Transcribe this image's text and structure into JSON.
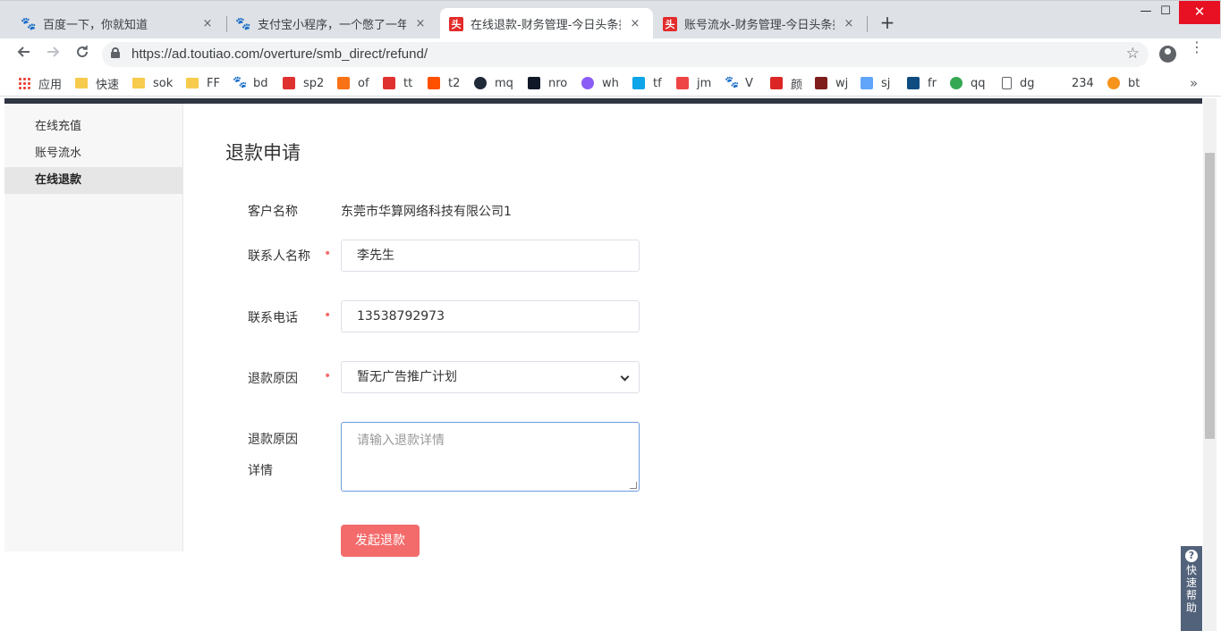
{
  "browser": {
    "tabs": [
      {
        "title": "百度一下，你就知道",
        "icon": "baidu-paw-icon"
      },
      {
        "title": "支付宝小程序，一个憋了一年的大",
        "icon": "baidu-paw-icon"
      },
      {
        "title": "在线退款-财务管理-今日头条投放",
        "icon": "toutiao-icon",
        "active": true
      },
      {
        "title": "账号流水-财务管理-今日头条投放",
        "icon": "toutiao-icon"
      }
    ],
    "favicon_text": "头",
    "close_glyph": "×",
    "new_tab_glyph": "+",
    "window_controls": {
      "minimize": "—",
      "maximize": "☐",
      "close": "✕"
    },
    "url": "https://ad.toutiao.com/overture/smb_direct/refund/",
    "bookmarks": [
      {
        "label": "应用",
        "icon": "apps-grid-icon"
      },
      {
        "label": "快速",
        "icon": "folder-icon"
      },
      {
        "label": "sok",
        "icon": "folder-icon"
      },
      {
        "label": "FF",
        "icon": "folder-icon"
      },
      {
        "label": "bd",
        "icon": "baidu-paw-icon"
      },
      {
        "label": "sp2",
        "icon": "wifi-icon"
      },
      {
        "label": "of",
        "icon": "flame-icon"
      },
      {
        "label": "tt",
        "icon": "red-badge-icon"
      },
      {
        "label": "t2",
        "icon": "taobao-icon"
      },
      {
        "label": "mq",
        "icon": "wave-icon"
      },
      {
        "label": "nro",
        "icon": "bag-icon"
      },
      {
        "label": "wh",
        "icon": "ring-icon"
      },
      {
        "label": "tf",
        "icon": "tf-icon"
      },
      {
        "label": "jm",
        "icon": "jm-icon"
      },
      {
        "label": "V",
        "icon": "baidu-paw-icon"
      },
      {
        "label": "颜",
        "icon": "fanyi-icon"
      },
      {
        "label": "wj",
        "icon": "w-logo-icon"
      },
      {
        "label": "sj",
        "icon": "sj-icon"
      },
      {
        "label": "fr",
        "icon": "fr-icon"
      },
      {
        "label": "qq",
        "icon": "google-icon"
      },
      {
        "label": "dg",
        "icon": "document-icon"
      },
      {
        "label": "234",
        "icon": ""
      },
      {
        "label": "bt",
        "icon": "bitcoin-icon"
      }
    ],
    "bookmarks_more": "»"
  },
  "sidebar": {
    "items": [
      {
        "label": "在线充值"
      },
      {
        "label": "账号流水"
      },
      {
        "label": "在线退款",
        "active": true
      }
    ]
  },
  "form": {
    "title": "退款申请",
    "customer_label": "客户名称",
    "customer_value": "东莞市华算网络科技有限公司1",
    "contact_label": "联系人名称",
    "contact_value": "李先生",
    "phone_label": "联系电话",
    "phone_value": "13538792973",
    "reason_label": "退款原因",
    "reason_value": "暂无广告推广计划",
    "detail_label_line1": "退款原因",
    "detail_label_line2": "详情",
    "detail_placeholder": "请输入退款详情",
    "required_mark": "•",
    "submit_label": "发起退款"
  },
  "help": {
    "icon": "?",
    "label": "快速帮助"
  },
  "colors": {
    "accent_red": "#f36b6b",
    "required_red": "#f56c6c",
    "sidebar_bg": "#f7f7f7",
    "page_topbar": "#2f3542",
    "help_bg": "#52627a"
  }
}
